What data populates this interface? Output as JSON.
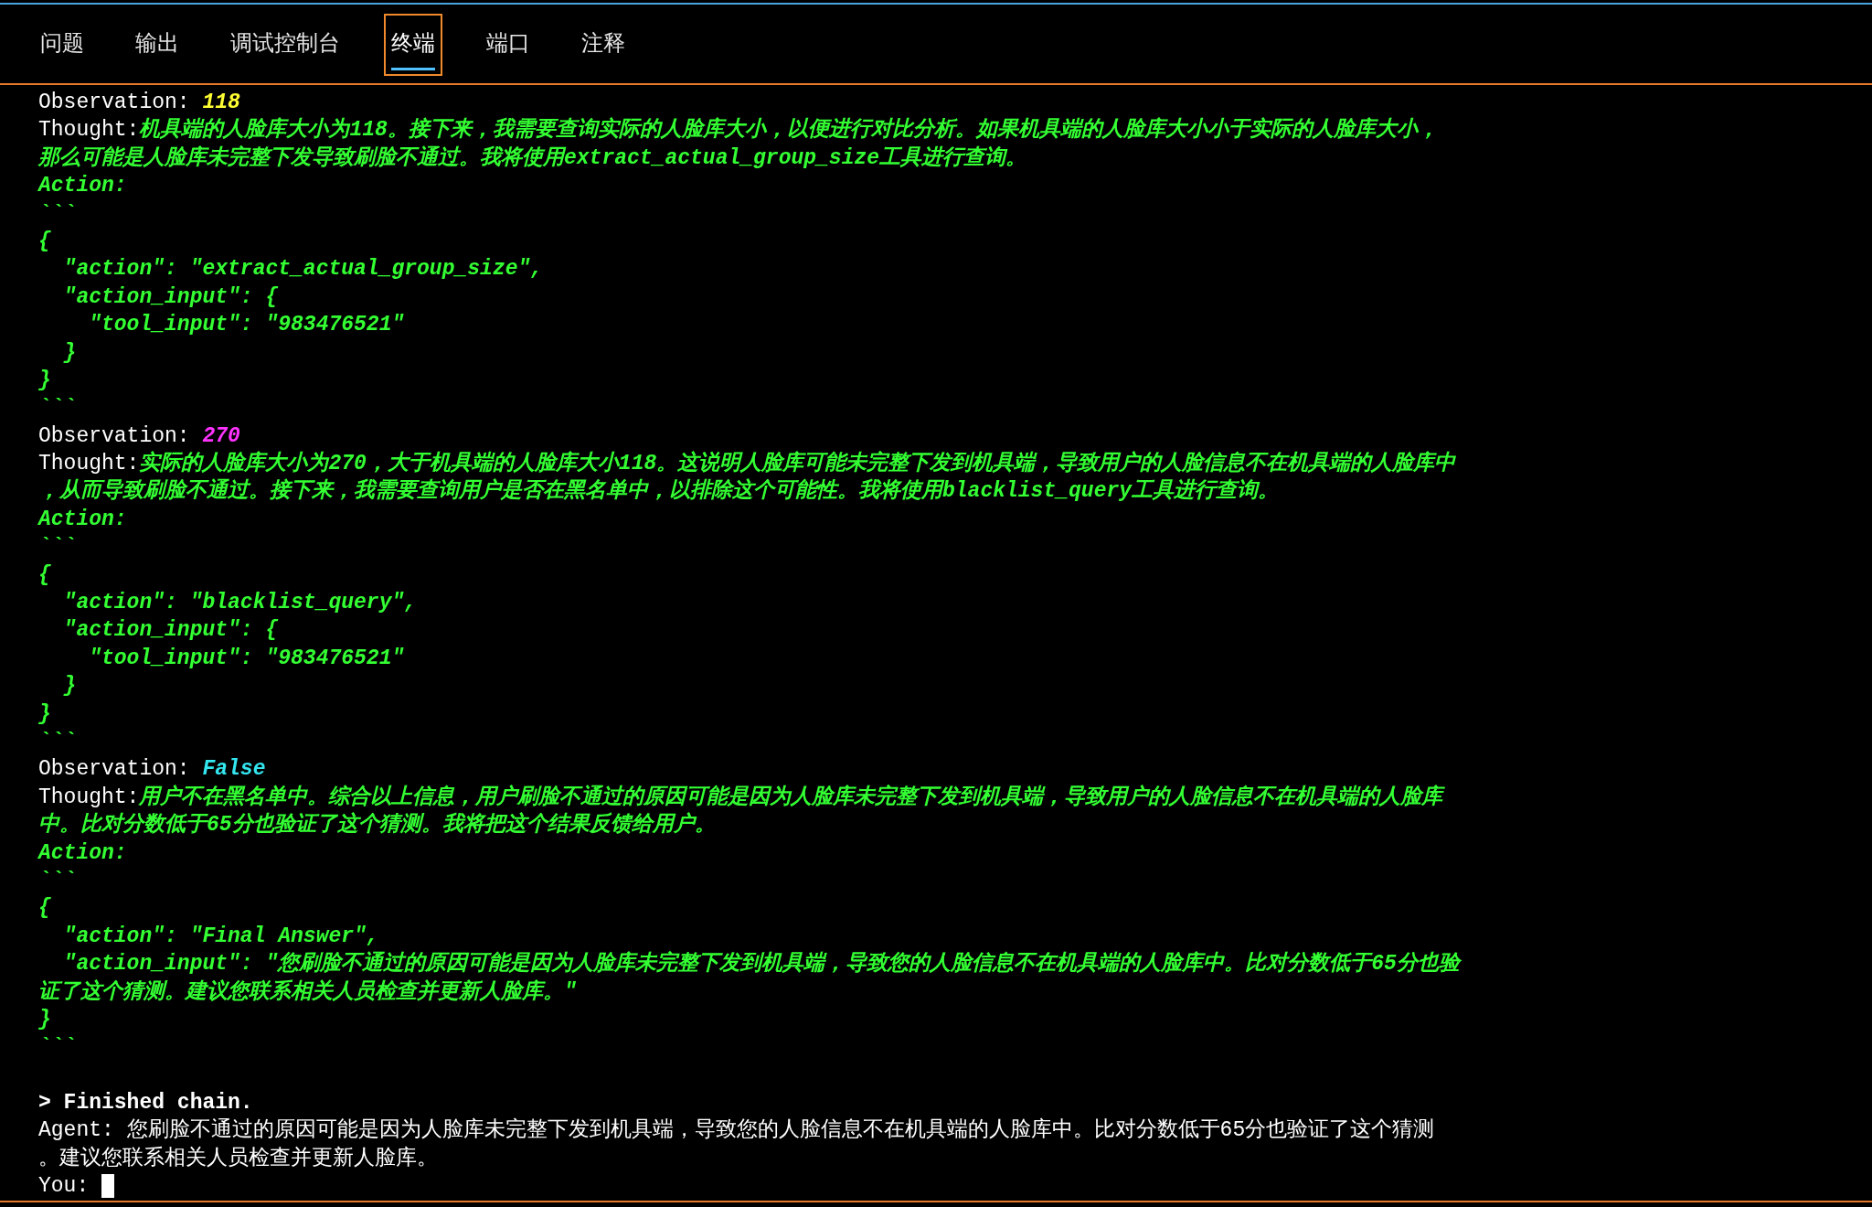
{
  "tabs": [
    {
      "label": "问题",
      "selected": false
    },
    {
      "label": "输出",
      "selected": false
    },
    {
      "label": "调试控制台",
      "selected": false
    },
    {
      "label": "终端",
      "selected": true
    },
    {
      "label": "端口",
      "selected": false
    },
    {
      "label": "注释",
      "selected": false
    }
  ],
  "terminal": {
    "lines": [
      {
        "segments": [
          {
            "kind": "plain",
            "text": "Observation: "
          },
          {
            "kind": "value",
            "text": "118",
            "color": "#ffff33"
          }
        ]
      },
      {
        "segments": [
          {
            "kind": "plain",
            "text": "Thought:"
          },
          {
            "kind": "green",
            "text": "机具端的人脸库大小为118。接下来，我需要查询实际的人脸库大小，以便进行对比分析。如果机具端的人脸库大小小于实际的人脸库大小，"
          }
        ]
      },
      {
        "segments": [
          {
            "kind": "green",
            "text": "那么可能是人脸库未完整下发导致刷脸不通过。我将使用extract_actual_group_size工具进行查询。"
          }
        ]
      },
      {
        "segments": [
          {
            "kind": "green",
            "text": "Action:"
          }
        ]
      },
      {
        "segments": [
          {
            "kind": "green",
            "text": "```"
          }
        ]
      },
      {
        "segments": [
          {
            "kind": "green",
            "text": "{"
          }
        ]
      },
      {
        "segments": [
          {
            "kind": "green",
            "text": "  \"action\": \"extract_actual_group_size\","
          }
        ]
      },
      {
        "segments": [
          {
            "kind": "green",
            "text": "  \"action_input\": {"
          }
        ]
      },
      {
        "segments": [
          {
            "kind": "green",
            "text": "    \"tool_input\": \"983476521\""
          }
        ]
      },
      {
        "segments": [
          {
            "kind": "green",
            "text": "  }"
          }
        ]
      },
      {
        "segments": [
          {
            "kind": "green",
            "text": "}"
          }
        ]
      },
      {
        "segments": [
          {
            "kind": "green",
            "text": "```"
          }
        ]
      },
      {
        "segments": [
          {
            "kind": "plain",
            "text": "Observation: "
          },
          {
            "kind": "value",
            "text": "270",
            "color": "#ff33ff"
          }
        ]
      },
      {
        "segments": [
          {
            "kind": "plain",
            "text": "Thought:"
          },
          {
            "kind": "green",
            "text": "实际的人脸库大小为270，大于机具端的人脸库大小118。这说明人脸库可能未完整下发到机具端，导致用户的人脸信息不在机具端的人脸库中"
          }
        ]
      },
      {
        "segments": [
          {
            "kind": "green",
            "text": "，从而导致刷脸不通过。接下来，我需要查询用户是否在黑名单中，以排除这个可能性。我将使用blacklist_query工具进行查询。"
          }
        ]
      },
      {
        "segments": [
          {
            "kind": "green",
            "text": "Action:"
          }
        ]
      },
      {
        "segments": [
          {
            "kind": "green",
            "text": "```"
          }
        ]
      },
      {
        "segments": [
          {
            "kind": "green",
            "text": "{"
          }
        ]
      },
      {
        "segments": [
          {
            "kind": "green",
            "text": "  \"action\": \"blacklist_query\","
          }
        ]
      },
      {
        "segments": [
          {
            "kind": "green",
            "text": "  \"action_input\": {"
          }
        ]
      },
      {
        "segments": [
          {
            "kind": "green",
            "text": "    \"tool_input\": \"983476521\""
          }
        ]
      },
      {
        "segments": [
          {
            "kind": "green",
            "text": "  }"
          }
        ]
      },
      {
        "segments": [
          {
            "kind": "green",
            "text": "}"
          }
        ]
      },
      {
        "segments": [
          {
            "kind": "green",
            "text": "```"
          }
        ]
      },
      {
        "segments": [
          {
            "kind": "plain",
            "text": "Observation: "
          },
          {
            "kind": "value",
            "text": "False",
            "color": "#33e6f0"
          }
        ]
      },
      {
        "segments": [
          {
            "kind": "plain",
            "text": "Thought:"
          },
          {
            "kind": "green",
            "text": "用户不在黑名单中。综合以上信息，用户刷脸不通过的原因可能是因为人脸库未完整下发到机具端，导致用户的人脸信息不在机具端的人脸库"
          }
        ]
      },
      {
        "segments": [
          {
            "kind": "green",
            "text": "中。比对分数低于65分也验证了这个猜测。我将把这个结果反馈给用户。"
          }
        ]
      },
      {
        "segments": [
          {
            "kind": "green",
            "text": "Action:"
          }
        ]
      },
      {
        "segments": [
          {
            "kind": "green",
            "text": "```"
          }
        ]
      },
      {
        "segments": [
          {
            "kind": "green",
            "text": "{"
          }
        ]
      },
      {
        "segments": [
          {
            "kind": "green",
            "text": "  \"action\": \"Final Answer\","
          }
        ]
      },
      {
        "segments": [
          {
            "kind": "green",
            "text": "  \"action_input\": \"您刷脸不通过的原因可能是因为人脸库未完整下发到机具端，导致您的人脸信息不在机具端的人脸库中。比对分数低于65分也验"
          }
        ]
      },
      {
        "segments": [
          {
            "kind": "green",
            "text": "证了这个猜测。建议您联系相关人员检查并更新人脸库。\""
          }
        ]
      },
      {
        "segments": [
          {
            "kind": "green",
            "text": "}"
          }
        ]
      },
      {
        "segments": [
          {
            "kind": "green",
            "text": "```"
          }
        ]
      },
      {
        "gap_before": true,
        "segments": [
          {
            "kind": "bold",
            "text": "> Finished chain."
          }
        ]
      },
      {
        "segments": [
          {
            "kind": "plain",
            "text": "Agent: 您刷脸不通过的原因可能是因为人脸库未完整下发到机具端，导致您的人脸信息不在机具端的人脸库中。比对分数低于65分也验证了这个猜测"
          }
        ]
      },
      {
        "segments": [
          {
            "kind": "plain",
            "text": "。建议您联系相关人员检查并更新人脸库。"
          }
        ]
      },
      {
        "segments": [
          {
            "kind": "plain",
            "text": "You: "
          }
        ],
        "cursor": true
      }
    ]
  }
}
